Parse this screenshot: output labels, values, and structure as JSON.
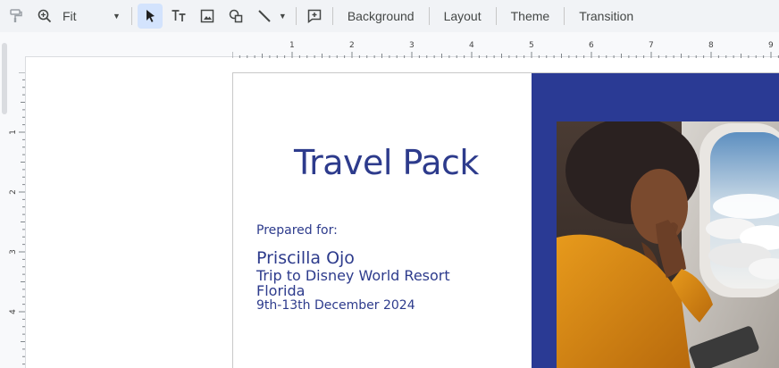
{
  "toolbar": {
    "zoom_label": "Fit",
    "tabs": {
      "background": "Background",
      "layout": "Layout",
      "theme": "Theme",
      "transition": "Transition"
    },
    "icons": [
      "paint-format-icon",
      "zoom-icon",
      "select-arrow-icon",
      "text-box-icon",
      "image-icon",
      "shape-icon",
      "line-icon",
      "add-comment-icon"
    ]
  },
  "ruler": {
    "top": [
      "1",
      "2",
      "3",
      "4",
      "5",
      "6",
      "7",
      "8",
      "9"
    ],
    "left": [
      "1",
      "2",
      "3",
      "4"
    ]
  },
  "slide": {
    "title": "Travel Pack",
    "prepared_label": "Prepared for:",
    "recipient_name": "Priscilla Ojo",
    "trip_line1": "Trip to Disney World Resort",
    "trip_line2": "Florida",
    "dates": "9th-13th December 2024",
    "accent_color": "#2a3a94",
    "text_color": "#2d3b8c"
  }
}
